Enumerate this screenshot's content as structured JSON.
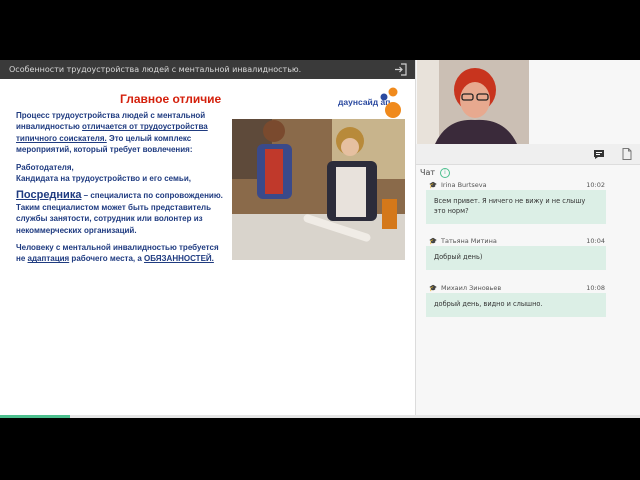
{
  "header": {
    "title": "Особенности трудоустройства людей с ментальной инвалидностью."
  },
  "slide": {
    "heading": "Главное отличие",
    "logo": "даунсайд ап",
    "p1_start": "Процесс трудоустройства людей с ментальной инвалидностью ",
    "p1_link": "отличается от трудоустройства типичного соискателя.",
    "p1_end": " Это целый комплекс мероприятий, который требует вовлечения:",
    "p2_line1": "Работодателя,",
    "p2_line2": "Кандидата на трудоустройство и его семьи,",
    "p3_emph": "Посредника",
    "p3_rest": " – специалиста по сопровождению. Таким специалистом может быть представитель службы занятости, сотрудник или волонтер из некоммерческих организаций.",
    "p4_start": "Человеку с ментальной инвалидностью требуется не ",
    "p4_link": "адаптация",
    "p4_mid": " рабочего места, а ",
    "p4_end": "ОБЯЗАННОСТЕЙ."
  },
  "chat": {
    "title": "Чат",
    "messages": [
      {
        "author": "Irina Burtseva",
        "time": "10:02",
        "text": "Всем привет. Я ничего не вижу и не слышу это норм?"
      },
      {
        "author": "Татьяна Митина",
        "time": "10:04",
        "text": "Добрый день)"
      },
      {
        "author": "Михаил Зиновьев",
        "time": "10:08",
        "text": "добрый день, видно и слышно."
      }
    ]
  },
  "colors": {
    "accent": "#4cbf8e",
    "slide_heading": "#d4200c",
    "slide_text": "#1f3b80",
    "bubble": "#dcefe6"
  },
  "icons": {
    "exit": "exit-icon",
    "chat_tab": "chat-icon",
    "notes_tab": "document-icon"
  }
}
